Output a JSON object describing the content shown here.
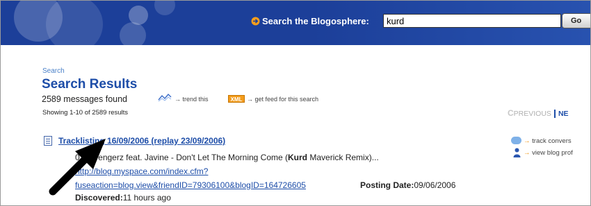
{
  "header": {
    "search_label": "Search the Blogosphere:",
    "search_value": "kurd",
    "go_label": "Go"
  },
  "breadcrumb": "Search",
  "page_title": "Search Results",
  "message_count": "2589 messages found",
  "trend_link": "→ trend this",
  "xml_badge": "XML",
  "feed_link": "→ get feed for this search",
  "showing": "Showing 1-10 of 2589 results",
  "pagination": {
    "prev_label": "PREVIOUS",
    "next_label": "NE"
  },
  "result": {
    "title": "Tracklisting 16/09/2006 (replay 23/09/2006)",
    "snippet_prefix": "03. Avengerz feat. Javine - Don't Let The Morning Come (",
    "snippet_keyword": "Kurd",
    "snippet_suffix": " Maverick Remix)...",
    "url_line1": "http://blog.myspace.com/index.cfm?",
    "url_line2": "fuseaction=blog.view&friendID=79306100&blogID=164726605",
    "posting_date_label": "Posting Date:",
    "posting_date_value": "09/06/2006",
    "discovered_label": "Discovered:",
    "discovered_value": "11 hours ago"
  },
  "sidebar": {
    "track_label": "track convers",
    "profile_label": "view blog prof"
  },
  "icons": {
    "search_arrow": "orange-circle-arrow-icon",
    "trend": "trend-graph-icon",
    "xml": "xml-feed-icon",
    "document": "document-icon",
    "track": "speech-bubble-icon",
    "profile": "person-icon",
    "pointer": "black-arrow-annotation"
  },
  "colors": {
    "header_bg": "#1c3f99",
    "link": "#1d4da8",
    "accent": "#f08c00"
  }
}
